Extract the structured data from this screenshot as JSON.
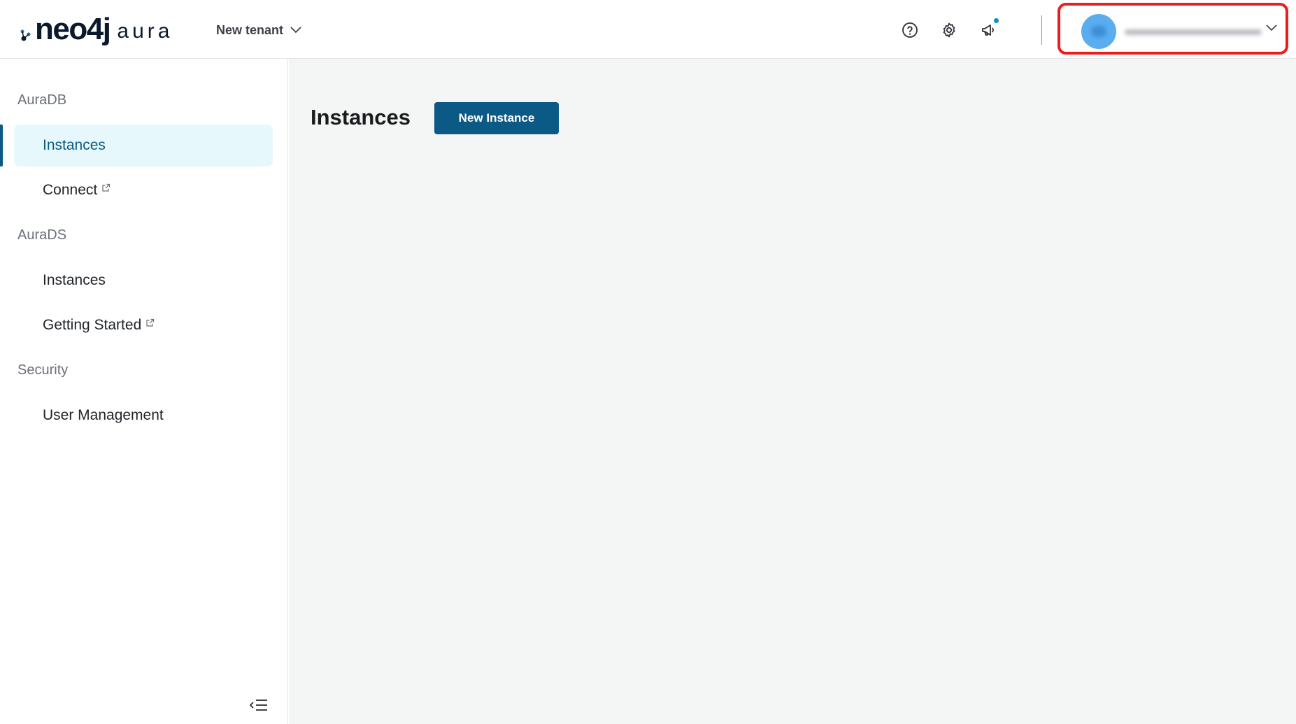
{
  "header": {
    "logo": {
      "word": "neo4j",
      "suffix": "aura"
    },
    "tenant_label": "New tenant",
    "icons": [
      "help-icon",
      "gear-icon",
      "megaphone-icon"
    ],
    "user_menu": {
      "highlight_color": "#ee1c1c",
      "avatar_color": "#5aaef0"
    }
  },
  "sidebar": {
    "sections": [
      {
        "label": "AuraDB",
        "items": [
          {
            "label": "Instances",
            "active": true,
            "external": false
          },
          {
            "label": "Connect",
            "active": false,
            "external": true
          }
        ]
      },
      {
        "label": "AuraDS",
        "items": [
          {
            "label": "Instances",
            "active": false,
            "external": false
          },
          {
            "label": "Getting Started",
            "active": false,
            "external": true
          }
        ]
      },
      {
        "label": "Security",
        "items": [
          {
            "label": "User Management",
            "active": false,
            "external": false
          }
        ]
      }
    ]
  },
  "main": {
    "title": "Instances",
    "new_instance_label": "New Instance"
  },
  "colors": {
    "accent": "#0b5a85",
    "active_bg": "#e6f8fc",
    "main_bg": "#f4f5f5"
  }
}
